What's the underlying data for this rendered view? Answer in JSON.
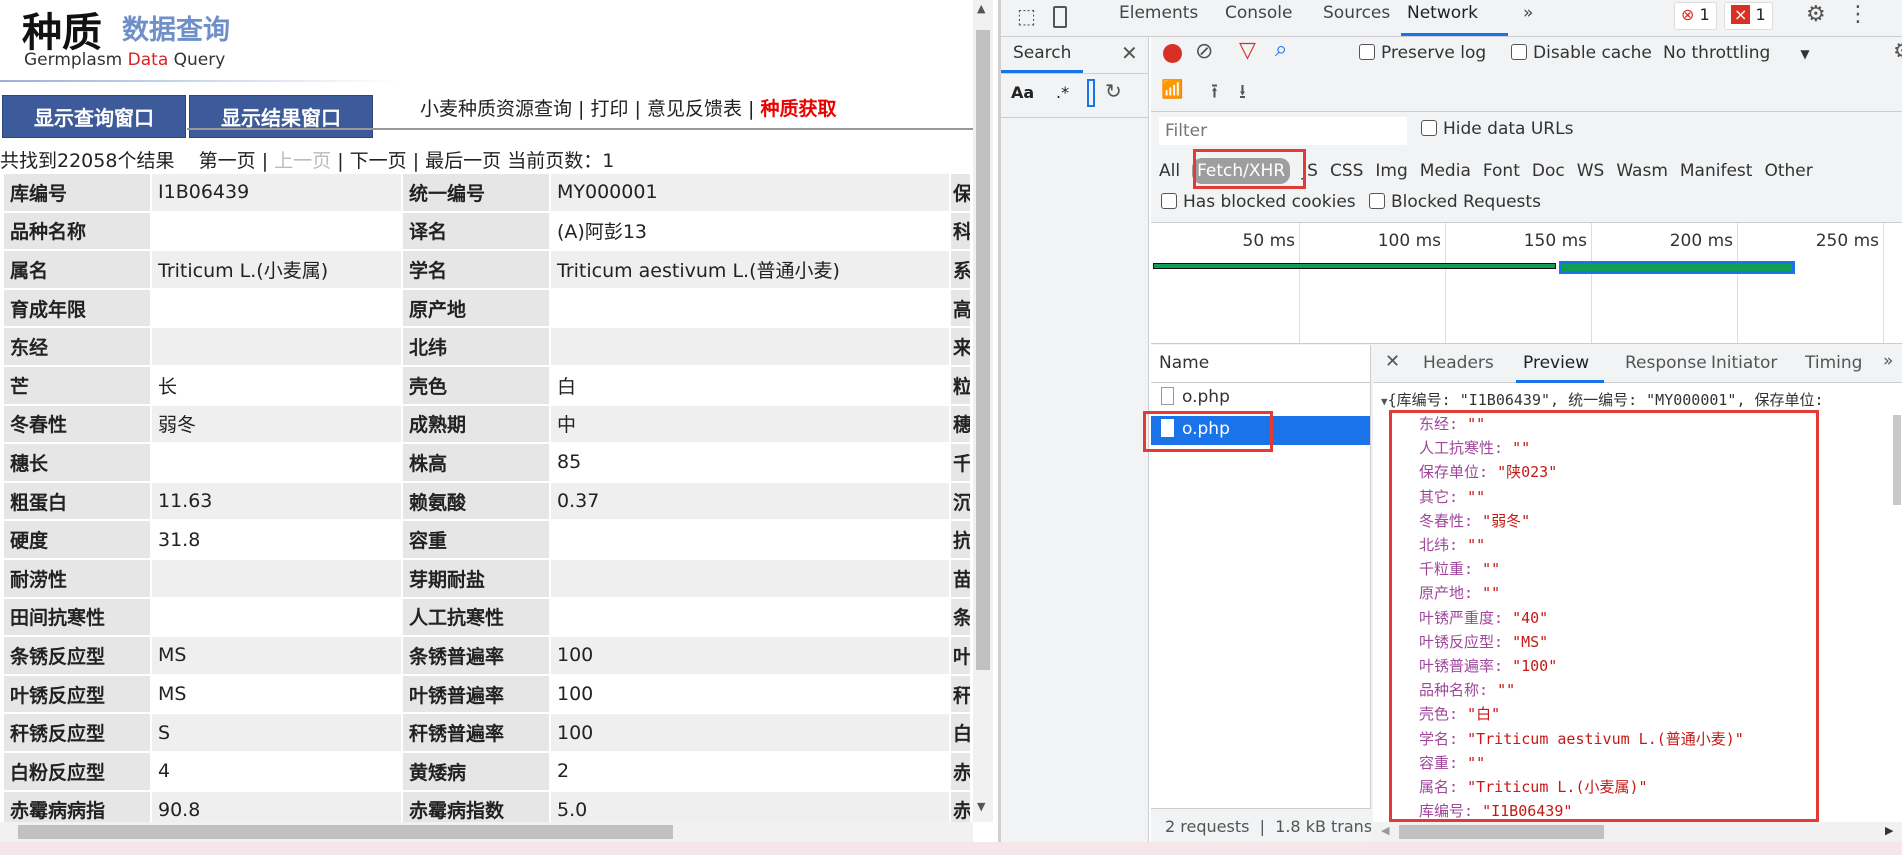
{
  "site": {
    "logo_cn_bold": "种质",
    "logo_cn_light": "数据查询",
    "logo_en_prefix": "Germplasm ",
    "logo_en_accent": "Data",
    "logo_en_suffix": " Query",
    "buttons": [
      "显示查询窗口",
      "显示结果窗口"
    ],
    "nav": {
      "links": [
        "小麦种质资源查询",
        "打印",
        "意见反馈表"
      ],
      "highlight": "种质获取",
      "sep": " | "
    },
    "pager": {
      "count": "共找到22058个结果",
      "first": "第一页",
      "prev": "上一页",
      "next": "下一页",
      "last": "最后一页",
      "current_label": "当前页数：",
      "current": "1",
      "sep": "|"
    },
    "rows": [
      [
        "库编号",
        "I1B06439",
        "统一编号",
        "MY000001",
        "保"
      ],
      [
        "品种名称",
        "",
        "译名",
        "(A)阿彭13",
        "科"
      ],
      [
        "属名",
        "Triticum L.(小麦属)",
        "学名",
        "Triticum aestivum L.(普通小麦)",
        "系"
      ],
      [
        "育成年限",
        "",
        "原产地",
        "",
        "高"
      ],
      [
        "东经",
        "",
        "北纬",
        "",
        "来"
      ],
      [
        "芒",
        "长",
        "壳色",
        "白",
        "粒"
      ],
      [
        "冬春性",
        "弱冬",
        "成熟期",
        "中",
        "穗"
      ],
      [
        "穗长",
        "",
        "株高",
        "85",
        "千"
      ],
      [
        "粗蛋白",
        "11.63",
        "赖氨酸",
        "0.37",
        "沉"
      ],
      [
        "硬度",
        "31.8",
        "容重",
        "",
        "抗"
      ],
      [
        "耐涝性",
        "",
        "芽期耐盐",
        "",
        "苗"
      ],
      [
        "田间抗寒性",
        "",
        "人工抗寒性",
        "",
        "条"
      ],
      [
        "条锈反应型",
        "MS",
        "条锈普遍率",
        "100",
        "叶"
      ],
      [
        "叶锈反应型",
        "MS",
        "叶锈普遍率",
        "100",
        "秆"
      ],
      [
        "秆锈反应型",
        "S",
        "秆锈普遍率",
        "100",
        "白"
      ],
      [
        "白粉反应型",
        "4",
        "黄矮病",
        "2",
        "赤"
      ],
      [
        "赤霉病病指",
        "90.8",
        "赤霉病指数",
        "5.0",
        "赤"
      ]
    ]
  },
  "devtools": {
    "tabs": [
      "Elements",
      "Console",
      "Sources",
      "Network"
    ],
    "active_tab": "Network",
    "more": "»",
    "errors": "1",
    "issues": "1",
    "search": {
      "label": "Search",
      "case": "Aa",
      "regex": ".*"
    },
    "toolbar": {
      "preserve_log": "Preserve log",
      "disable_cache": "Disable cache",
      "throttling": "No throttling"
    },
    "filter": {
      "placeholder": "Filter",
      "hide_data_urls": "Hide data URLs"
    },
    "types": [
      "All",
      "Fetch/XHR",
      "JS",
      "CSS",
      "Img",
      "Media",
      "Font",
      "Doc",
      "WS",
      "Wasm",
      "Manifest",
      "Other"
    ],
    "active_type": "Fetch/XHR",
    "blocked": {
      "cookies": "Has blocked cookies",
      "requests": "Blocked Requests"
    },
    "timeline": {
      "ticks": [
        "50 ms",
        "100 ms",
        "150 ms",
        "200 ms",
        "250 ms"
      ]
    },
    "names": {
      "header": "Name",
      "items": [
        "o.php",
        "o.php"
      ],
      "selected": 1
    },
    "footer": {
      "requests": "2 requests",
      "transferred": "1.8 kB trans"
    },
    "detail_tabs": [
      "Headers",
      "Preview",
      "Response",
      "Initiator",
      "Timing"
    ],
    "active_detail": "Preview",
    "preview": {
      "summary": "{库编号: \"I1B06439\", 统一编号: \"MY000001\", 保存单位:",
      "fields": [
        [
          "东经",
          "\"\""
        ],
        [
          "人工抗寒性",
          "\"\""
        ],
        [
          "保存单位",
          "\"陕023\""
        ],
        [
          "其它",
          "\"\""
        ],
        [
          "冬春性",
          "\"弱冬\""
        ],
        [
          "北纬",
          "\"\""
        ],
        [
          "千粒重",
          "\"\""
        ],
        [
          "原产地",
          "\"\""
        ],
        [
          "叶锈严重度",
          "\"40\""
        ],
        [
          "叶锈反应型",
          "\"MS\""
        ],
        [
          "叶锈普遍率",
          "\"100\""
        ],
        [
          "品种名称",
          "\"\""
        ],
        [
          "壳色",
          "\"白\""
        ],
        [
          "学名",
          "\"Triticum aestivum L.(普通小麦)\""
        ],
        [
          "容重",
          "\"\""
        ],
        [
          "属名",
          "\"Triticum L.(小麦属)\""
        ],
        [
          "库编号",
          "\"I1B06439\""
        ]
      ]
    }
  },
  "colors": {
    "brand_blue": "#3d5a9a",
    "highlight_red": "#e53935",
    "selected_blue": "#1a73e8"
  }
}
